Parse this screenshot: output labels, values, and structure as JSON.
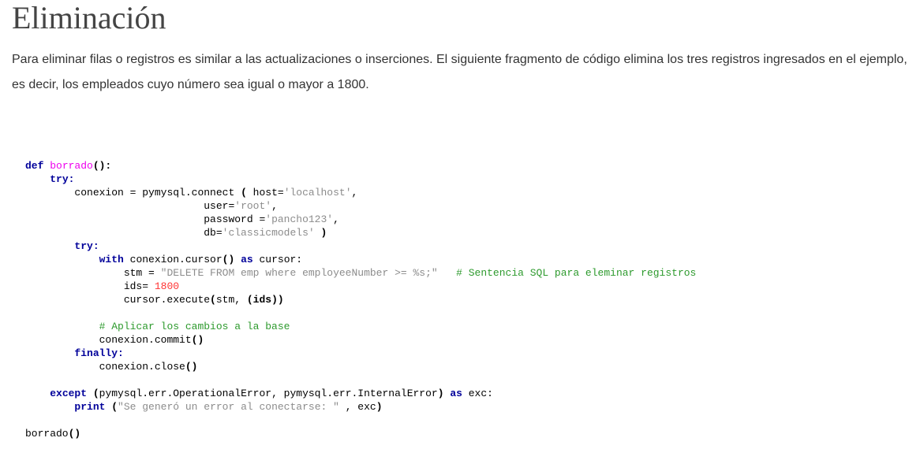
{
  "page": {
    "title": "Eliminación",
    "intro": "Para eliminar filas o registros es similar a las actualizaciones o inserciones. El siguiente fragmento de código elimina los tres registros ingresados en el ejemplo, es decir, los empleados cuyo número sea igual o mayor a 1800."
  },
  "code": {
    "l1": {
      "kw": "def",
      "fn": "borrado",
      "paren": "():"
    },
    "l2": {
      "kw": "try",
      "colon": ":"
    },
    "l3": {
      "text": "conexion = pymysql.connect ",
      "paren": "(",
      "arg": " host=",
      "str": "'localhost'",
      "end": ","
    },
    "l4": {
      "arg": "user=",
      "str": "'root'",
      "end": ","
    },
    "l5": {
      "arg": "password =",
      "str": "'pancho123'",
      "end": ","
    },
    "l6": {
      "arg": "db=",
      "str": "'classicmodels'",
      "end": " )"
    },
    "l7": {
      "kw": "try",
      "colon": ":"
    },
    "l8": {
      "kw": "with",
      "text1": " conexion.cursor",
      "paren": "()",
      "kw2": " as",
      "text2": " cursor:"
    },
    "l9": {
      "text": "stm = ",
      "str": "\"DELETE FROM emp where employeeNumber >= %s;\"",
      "cm": "# Sentencia SQL para eleminar registros"
    },
    "l10": {
      "text": "ids= ",
      "num": "1800"
    },
    "l11": {
      "text": "cursor.execute",
      "paren1": "(",
      "text2": "stm, ",
      "paren2": "(ids))"
    },
    "l13": {
      "cm": "# Aplicar los cambios a la base"
    },
    "l14": {
      "text": "conexion.commit",
      "paren": "()"
    },
    "l15": {
      "kw": "finally",
      "colon": ":"
    },
    "l16": {
      "text": "conexion.close",
      "paren": "()"
    },
    "l18": {
      "kw": "except",
      "paren1": " (",
      "text": "pymysql.err.OperationalError, pymysql.err.InternalError",
      "paren2": ")",
      "kw2": " as",
      "text2": " exc:"
    },
    "l19": {
      "kw": "print",
      "paren1": " (",
      "str": "\"Se generó un error al conectarse: \"",
      "text": " , exc",
      "paren2": ")"
    },
    "l21": {
      "text": "borrado",
      "paren": "()"
    }
  }
}
